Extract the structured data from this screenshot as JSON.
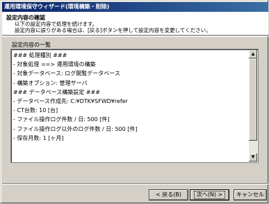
{
  "window": {
    "title": "運用環境保守ウィザード(環境構築・削除)"
  },
  "header": {
    "title": "設定内容の確認",
    "description_line1": "以下の設定内容で処理を続けます。",
    "description_line2": "設定内容に誤りがある場合は、[戻る]ボタンを押して設定内容を変更してください。"
  },
  "settings_list": {
    "label": "設定内容の一覧",
    "lines": [
      "### 処理種別 ###",
      "- 対象処理 ==> 運用環境の構築",
      "- 対象データベース: ログ閲覧データベース",
      "- 構築オプション: 管理サーバ",
      "### データベース構築設定 ###",
      "- データベース作成先: C:¥DTK¥SFWD¥refer",
      "- CT台数: 10 [台]",
      "- ファイル操作ログ件数 / 日: 500 [件]",
      "- ファイル操作ログ以外のログ件数 / 日: 500 [件]",
      "- 保存月数: 1 [ヶ月]",
      "",
      ""
    ]
  },
  "buttons": {
    "back": "< 戻る(B)",
    "next": "次へ(N) >",
    "cancel": "キャンセル"
  },
  "icons": {
    "scroll_up": "▲",
    "scroll_down": "▼"
  }
}
